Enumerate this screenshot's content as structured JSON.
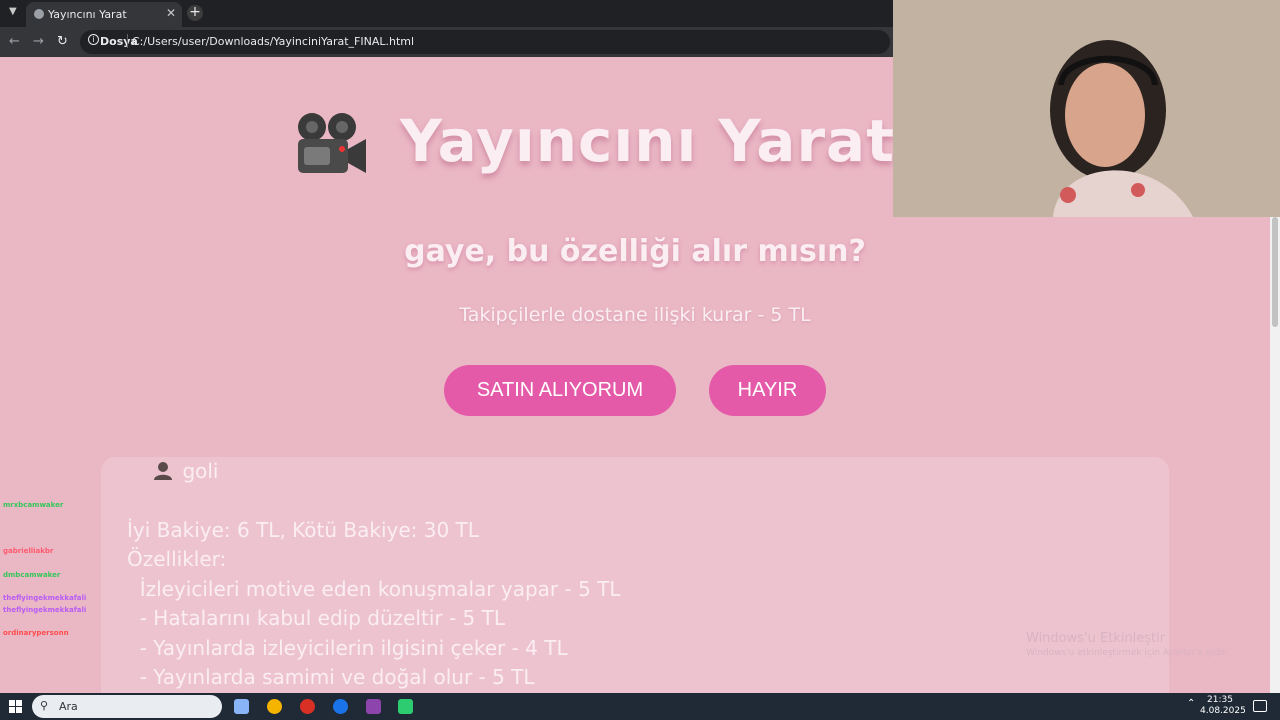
{
  "browser": {
    "tab_title": "Yayıncını Yarat",
    "omnibox_scheme": "Dosya",
    "url": "C:/Users/user/Downloads/YayinciniYarat_FINAL.html"
  },
  "page": {
    "title": "Yayıncını Yarat",
    "question": "gaye, bu özelliği alır mısın?",
    "offer": "Takipçilerle dostane ilişki kurar - 5 TL",
    "buy_label": "SATIN ALIYORUM",
    "no_label": "HAYIR"
  },
  "character": {
    "name": "goli",
    "balance": "İyi Bakiye: 6 TL, Kötü Bakiye: 30 TL",
    "features_heading": "Özellikler:",
    "features": [
      "  İzleyicileri motive eden konuşmalar yapar - 5 TL",
      "  - Hatalarını kabul edip düzeltir - 5 TL",
      "  - Yayınlarda izleyicilerin ilgisini çeker - 4 TL",
      "  - Yayınlarda samimi ve doğal olur - 5 TL"
    ]
  },
  "chat": [
    {
      "user": "mrxbcamwaker",
      "msg": "",
      "color": "#34c759"
    },
    {
      "user": "gabrielliakbr",
      "msg": "",
      "color": "#ff5a6e"
    },
    {
      "user": "dmbcamwaker",
      "msg": "",
      "color": "#34c759"
    },
    {
      "user": "theflyingekmekkafali",
      "msg": "",
      "color": "#b95cf4"
    },
    {
      "user": "theflyingekmekkafali",
      "msg": "",
      "color": "#b95cf4"
    },
    {
      "user": "ordinarypersonn",
      "msg": "",
      "color": "#ff4d4d"
    }
  ],
  "watermark": {
    "line1": "Windows'u Etkinleştir",
    "line2": "Windows'u etkinleştirmek için Ayarlar'a gidin."
  },
  "taskbar": {
    "search_placeholder": "Ara",
    "time": "21:35",
    "date": "4.08.2025"
  }
}
